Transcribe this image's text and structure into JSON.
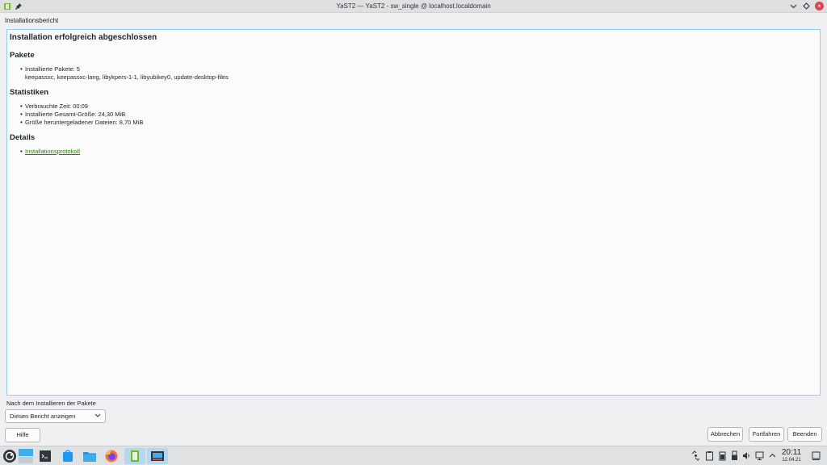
{
  "window": {
    "title": "YaST2 — YaST2 - sw_single @ localhost.localdomain",
    "icons": [
      "yast-app-icon",
      "pin-icon",
      "minimize-icon",
      "maximize-icon",
      "close-icon"
    ]
  },
  "section_label": "Installationsbericht",
  "report": {
    "heading": "Installation erfolgreich abgeschlossen",
    "packages": {
      "title": "Pakete",
      "installed_label": "Installierte Pakete: 5",
      "installed_list": "keepassxc, keepassxc-lang, libykpers-1-1, libyubikey0, update-desktop-files"
    },
    "statistics": {
      "title": "Statistiken",
      "time": "Verbrauchte Zeit: 00:09",
      "total_size": "Installierte Gesamt-Größe: 24,30 MiB",
      "download_size": "Größe heruntergeladener Dateien: 8,70 MiB"
    },
    "details": {
      "title": "Details",
      "log_link": "Installationsprotokoll"
    },
    "bullet": "•"
  },
  "after_install": {
    "label": "Nach dem Installieren der Pakete",
    "selected": "Diesen Bericht anzeigen"
  },
  "buttons": {
    "help": "Hilfe",
    "abort": "Abbrechen",
    "continue": "Fortfahren",
    "finish": "Beenden"
  },
  "taskbar": {
    "time": "20:11",
    "date": "12.04.21",
    "apps": [
      "opensuse-menu-icon",
      "desktop-pager-icon",
      "terminal-icon",
      "software-store-icon",
      "file-manager-icon",
      "firefox-icon",
      "yast-icon",
      "yast-control-icon"
    ],
    "tray": [
      "network-icon",
      "clipboard-icon",
      "battery-icon",
      "usb-icon",
      "volume-icon",
      "display-icon",
      "chevron-up-icon"
    ]
  },
  "colors": {
    "accent": "#3daee9",
    "link": "#2a7a0f",
    "close": "#da4453"
  }
}
